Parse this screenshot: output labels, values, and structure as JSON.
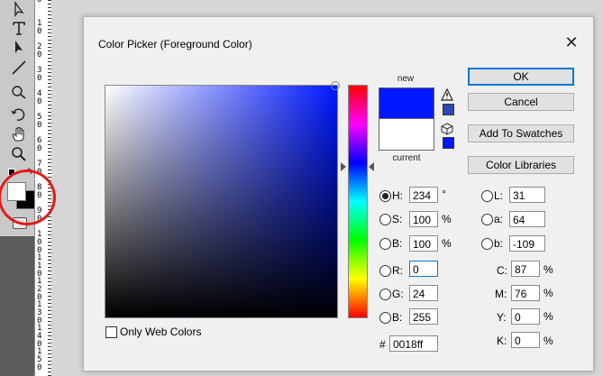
{
  "toolbar": {
    "icons": [
      "path-select-icon",
      "type-icon",
      "direct-select-icon",
      "line-icon",
      "spot-healing-icon",
      "history-brush-icon",
      "hand-icon",
      "zoom-icon"
    ],
    "foreground_color": "#ffffff",
    "background_color": "#000000"
  },
  "ruler": {
    "labels": [
      "0",
      "1\n0",
      "2\n0",
      "3\n0",
      "4\n0",
      "5\n0",
      "6\n0",
      "7\n0",
      "8\n0",
      "9\n0",
      "1\n0\n0",
      "1\n1\n0",
      "1\n2\n0",
      "1\n3\n0",
      "1\n4\n0",
      "1\n5\n0",
      "1\n6\n0"
    ]
  },
  "dialog": {
    "title": "Color Picker (Foreground Color)",
    "close_label": "✕",
    "new_label": "new",
    "current_label": "current",
    "new_color": "#0018ff",
    "current_color": "#ffffff",
    "gamut_warning_color": "#2e47b8",
    "web_safe_color": "#0018ff",
    "buttons": {
      "ok": "OK",
      "cancel": "Cancel",
      "add_to_swatches": "Add To Swatches",
      "color_libraries": "Color Libraries"
    },
    "hsb": {
      "h_label": "H:",
      "h_value": "234",
      "h_unit": "°",
      "s_label": "S:",
      "s_value": "100",
      "s_unit": "%",
      "b_label": "B:",
      "b_value": "100",
      "b_unit": "%"
    },
    "rgb": {
      "r_label": "R:",
      "r_value": "0",
      "g_label": "G:",
      "g_value": "24",
      "b_label": "B:",
      "b_value": "255"
    },
    "lab": {
      "l_label": "L:",
      "l_value": "31",
      "a_label": "a:",
      "a_value": "64",
      "b_label": "b:",
      "b_value": "-109"
    },
    "cmyk": {
      "c_label": "C:",
      "c_value": "87",
      "c_unit": "%",
      "m_label": "M:",
      "m_value": "76",
      "m_unit": "%",
      "y_label": "Y:",
      "y_value": "0",
      "y_unit": "%",
      "k_label": "K:",
      "k_value": "0",
      "k_unit": "%"
    },
    "hex_label": "#",
    "hex_value": "0018ff",
    "only_web_colors_label": "Only Web Colors",
    "selected_mode": "H"
  },
  "annotation": {
    "circle_color": "#e41b1b"
  }
}
